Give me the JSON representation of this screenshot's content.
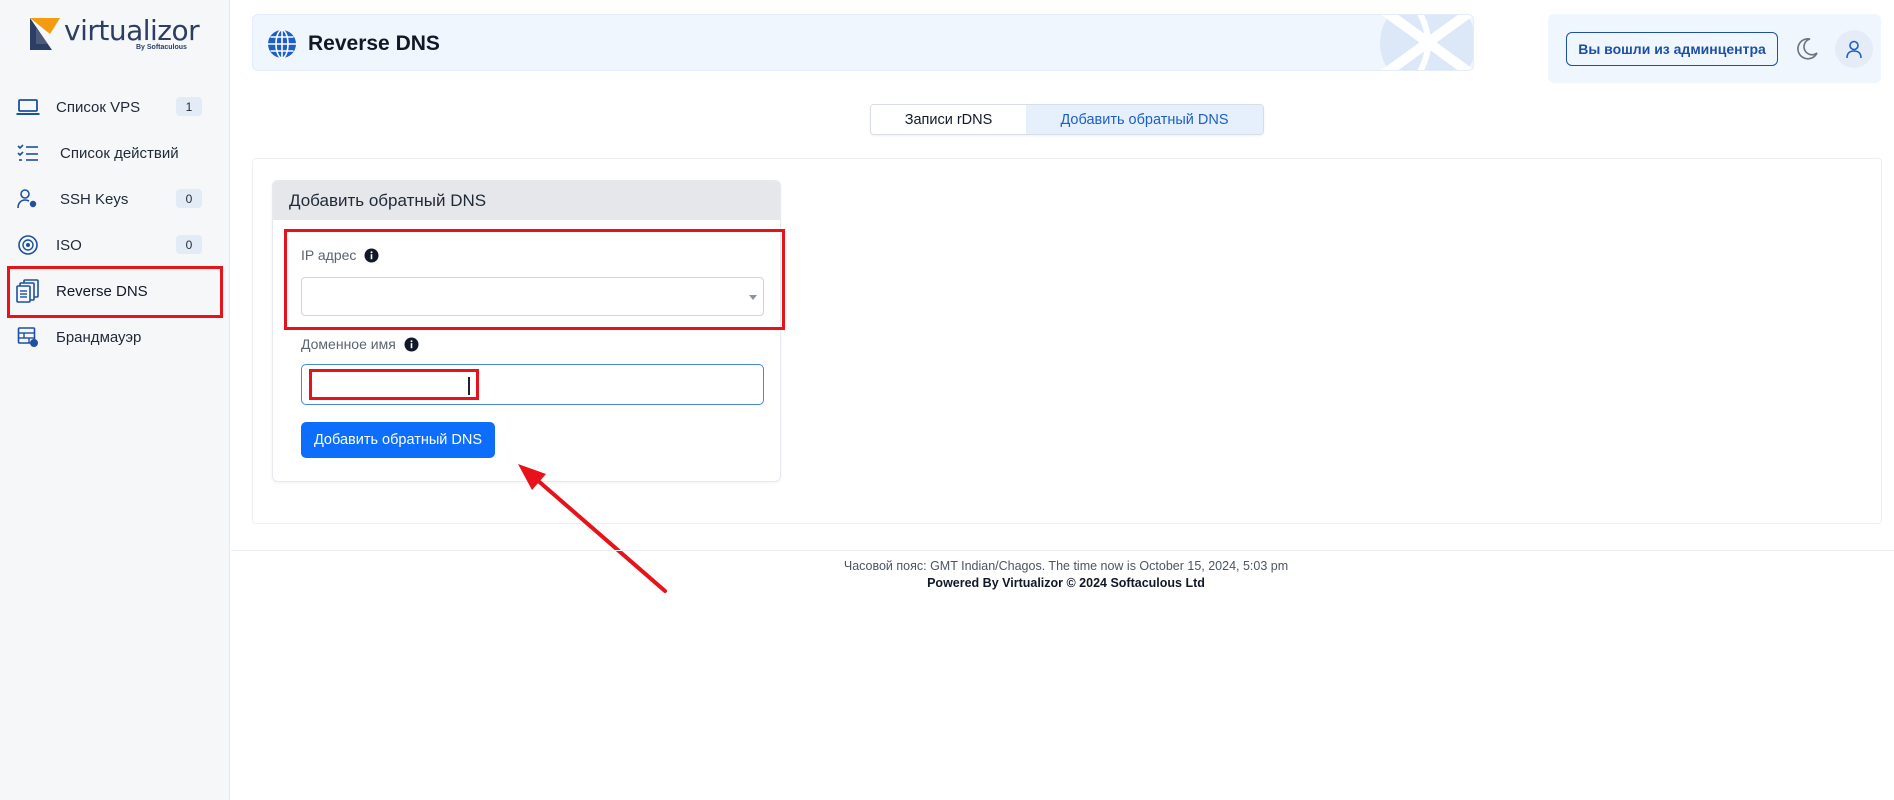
{
  "brand": {
    "name": "virtualizor",
    "sub": "By Softaculous"
  },
  "sidebar": {
    "items": [
      {
        "label": "Список VPS",
        "badge": "1",
        "icon": "laptop-icon"
      },
      {
        "label": "Список действий",
        "badge": null,
        "icon": "task-list-icon"
      },
      {
        "label": "SSH Keys",
        "badge": "0",
        "icon": "user-key-icon"
      },
      {
        "label": "ISO",
        "badge": "0",
        "icon": "disc-icon"
      },
      {
        "label": "Reverse DNS",
        "badge": null,
        "icon": "documents-icon",
        "active": true
      },
      {
        "label": "Брандмауэр",
        "badge": null,
        "icon": "firewall-icon"
      }
    ]
  },
  "header": {
    "title": "Reverse DNS",
    "icon": "globe-icon"
  },
  "top_right": {
    "admin_button": "Вы вошли из админцентра",
    "theme_icon": "moon-icon",
    "user_icon": "user-icon"
  },
  "tabs": [
    {
      "label": "Записи rDNS",
      "active": false
    },
    {
      "label": "Добавить обратный DNS",
      "active": true
    }
  ],
  "form": {
    "title": "Добавить обратный DNS",
    "ip_label": "IP адрес",
    "ip_value": "",
    "domain_label": "Доменное имя",
    "domain_value": "",
    "submit_label": "Добавить обратный DNS"
  },
  "footer": {
    "timezone_text": "Часовой пояс: GMT Indian/Chagos. The time now is October 15, 2024, 5:03 pm",
    "powered": "Powered By Virtualizor © 2024 Softaculous Ltd"
  },
  "colors": {
    "accent": "#0d6efd",
    "highlight": "#e8121b",
    "header_bg": "#f0f6fe",
    "brand_navy": "#2c3e64",
    "brand_orange": "#f39c12"
  }
}
